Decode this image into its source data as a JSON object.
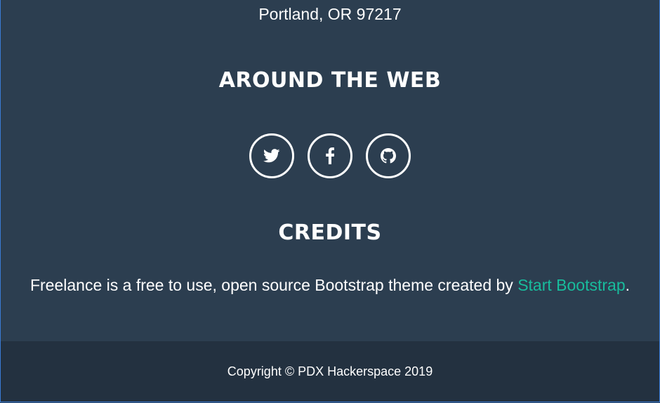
{
  "footer": {
    "address": "Portland, OR 97217",
    "around_title": "AROUND THE WEB",
    "social": [
      {
        "name": "twitter",
        "icon": "twitter-icon"
      },
      {
        "name": "facebook",
        "icon": "facebook-icon"
      },
      {
        "name": "github",
        "icon": "github-icon"
      }
    ],
    "credits_title": "CREDITS",
    "credits_prefix": "Freelance is a free to use, open source Bootstrap theme created by ",
    "credits_link": "Start Bootstrap",
    "credits_suffix": ".",
    "copyright": "Copyright © PDX Hackerspace 2019"
  },
  "colors": {
    "background": "#2c3e50",
    "copyright_background": "#233140",
    "link": "#18bc9c",
    "text": "#ffffff"
  }
}
